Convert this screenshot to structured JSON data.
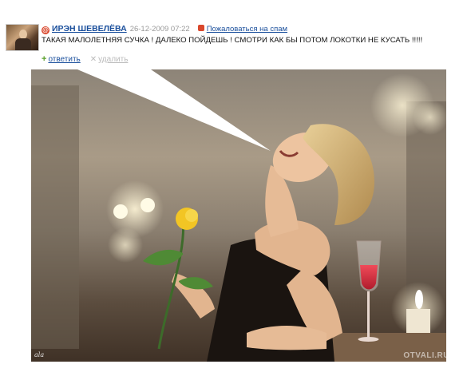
{
  "comment": {
    "author": "ИРЭН ШЕВЕЛЁВА",
    "date": "26-12-2009 07:22",
    "spam_link": "Пожаловаться на спам",
    "text": "ТАКАЯ МАЛОЛЕТНЯЯ СУЧКА ! ДАЛЕКО ПОЙДЕШЬ ! СМОТРИ КАК БЫ ПОТОМ ЛОКОТКИ НЕ КУСАТЬ !!!!!",
    "reply_label": "ответить",
    "delete_label": "удалить"
  },
  "icons": {
    "author": "at-icon",
    "spam": "warning-icon",
    "reply": "plus-icon",
    "delete": "x-icon"
  },
  "colors": {
    "link": "#1a4f9c",
    "accent": "#d9472c",
    "reply_icon": "#5aa02c",
    "muted": "#bbbbbb"
  },
  "photo": {
    "watermark_left": "ala",
    "watermark_right": "OTVALI.RU"
  }
}
